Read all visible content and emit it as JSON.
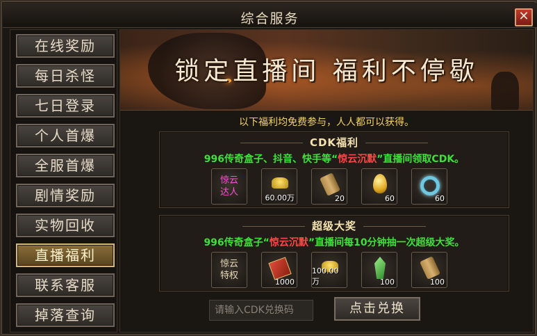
{
  "window": {
    "title": "综合服务",
    "close_label": "✕"
  },
  "sidebar": {
    "items": [
      {
        "label": "在线奖励",
        "active": false
      },
      {
        "label": "每日杀怪",
        "active": false
      },
      {
        "label": "七日登录",
        "active": false
      },
      {
        "label": "个人首爆",
        "active": false
      },
      {
        "label": "全服首爆",
        "active": false
      },
      {
        "label": "剧情奖励",
        "active": false
      },
      {
        "label": "实物回收",
        "active": false
      },
      {
        "label": "直播福利",
        "active": true
      },
      {
        "label": "联系客服",
        "active": false
      },
      {
        "label": "掉落查询",
        "active": false
      }
    ]
  },
  "banner": {
    "text": "锁定直播间 福利不停歇"
  },
  "intro": "以下福利均免费参与，人人都可以获得。",
  "cdk_panel": {
    "title": "CDK福利",
    "desc_prefix": "996传奇盒子、抖音、快手等“",
    "desc_highlight": "惊云沉默",
    "desc_suffix": "”直播间领取CDK。",
    "items": [
      {
        "icon": "title-badge",
        "label_line1": "惊云",
        "label_line2": "达人",
        "qty": ""
      },
      {
        "icon": "gold-ingot-icon",
        "qty": "60.00万"
      },
      {
        "icon": "scroll-icon",
        "qty": "20"
      },
      {
        "icon": "golden-egg-icon",
        "qty": "60"
      },
      {
        "icon": "ring-icon",
        "qty": "60"
      }
    ]
  },
  "big_prize_panel": {
    "title": "超级大奖",
    "desc_prefix": "996传奇盒子“",
    "desc_highlight": "惊云沉默",
    "desc_suffix": "”直播间每10分钟抽一次超级大奖。",
    "items": [
      {
        "icon": "privilege-badge",
        "label_line1": "惊云",
        "label_line2": "特权",
        "qty": ""
      },
      {
        "icon": "red-book-icon",
        "qty": "1000"
      },
      {
        "icon": "gold-ingot-icon",
        "qty": "100.00万"
      },
      {
        "icon": "green-gem-icon",
        "qty": "100"
      },
      {
        "icon": "scroll-icon",
        "qty": "100"
      }
    ]
  },
  "redeem": {
    "placeholder": "请输入CDK兑换码",
    "button_label": "点击兑换"
  },
  "colors": {
    "highlight_green": "#3ee03a",
    "highlight_red": "#ff4646",
    "intro_yellow": "#f3d36a",
    "badge_pink": "#ff4fd8"
  }
}
